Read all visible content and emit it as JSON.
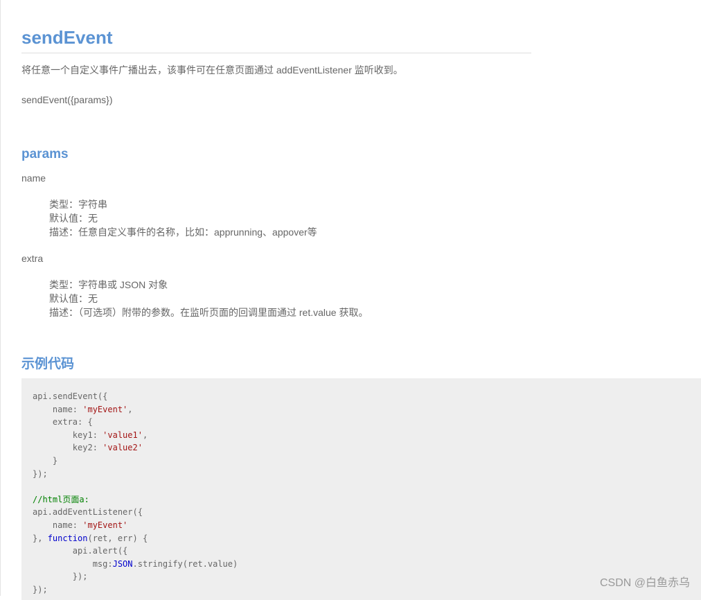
{
  "doc": {
    "title": "sendEvent",
    "description": "将任意一个自定义事件广播出去，该事件可在任意页面通过 addEventListener 监听收到。",
    "signature": "sendEvent({params})"
  },
  "params_section": {
    "heading": "params",
    "items": [
      {
        "name": "name",
        "type": "类型：字符串",
        "default": "默认值：无",
        "desc": "描述：任意自定义事件的名称，比如：apprunning、appover等"
      },
      {
        "name": "extra",
        "type": "类型：字符串或 JSON 对象",
        "default": "默认值：无",
        "desc": "描述：（可选项）附带的参数。在监听页面的回调里面通过 ret.value 获取。"
      }
    ]
  },
  "example_section": {
    "heading": "示例代码",
    "code": {
      "l1": "api.sendEvent({",
      "l2a": "    name: ",
      "l2s": "'myEvent'",
      "l2b": ",",
      "l3": "    extra: {",
      "l4a": "        key1: ",
      "l4s": "'value1'",
      "l4b": ",",
      "l5a": "        key2: ",
      "l5s": "'value2'",
      "l6": "    }",
      "l7": "});",
      "l9": "//html页面a:",
      "l10": "api.addEventListener({",
      "l11a": "    name: ",
      "l11s": "'myEvent'",
      "l12a": "}, ",
      "l12k": "function",
      "l12b": "(ret, err) {",
      "l13": "        api.alert({",
      "l14a": "            msg:",
      "l14k": "JSON",
      "l14b": ".stringify(ret.value)",
      "l15": "        });",
      "l16": "});"
    }
  },
  "watermark": "CSDN @白鱼赤乌"
}
